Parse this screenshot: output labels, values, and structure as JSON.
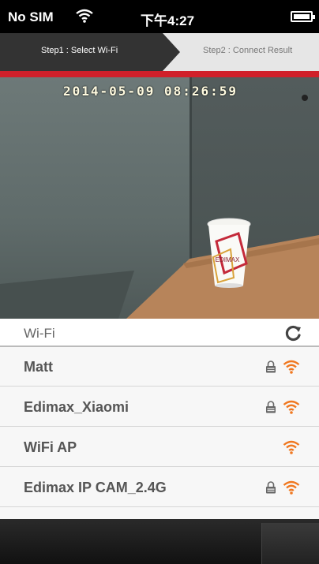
{
  "status_bar": {
    "carrier": "No SIM",
    "time": "下午4:27",
    "wifi_icon": "wifi-icon",
    "battery_icon": "battery-icon"
  },
  "steps": {
    "step1_label": "Step1 : Select Wi-Fi",
    "step2_label": "Step2 : Connect Result"
  },
  "camera": {
    "timestamp": "2014-05-09 08:26:59",
    "cup_text": "EDIMAX"
  },
  "wifi": {
    "title": "Wi-Fi",
    "refresh_icon": "refresh-icon",
    "networks": [
      {
        "name": "Matt",
        "locked": true
      },
      {
        "name": "Edimax_Xiaomi",
        "locked": true
      },
      {
        "name": "WiFi AP",
        "locked": false
      },
      {
        "name": "Edimax IP CAM_2.4G",
        "locked": true
      }
    ]
  },
  "colors": {
    "accent_red": "#d0202a",
    "signal_orange": "#f07820",
    "step_active_bg": "#333333"
  }
}
